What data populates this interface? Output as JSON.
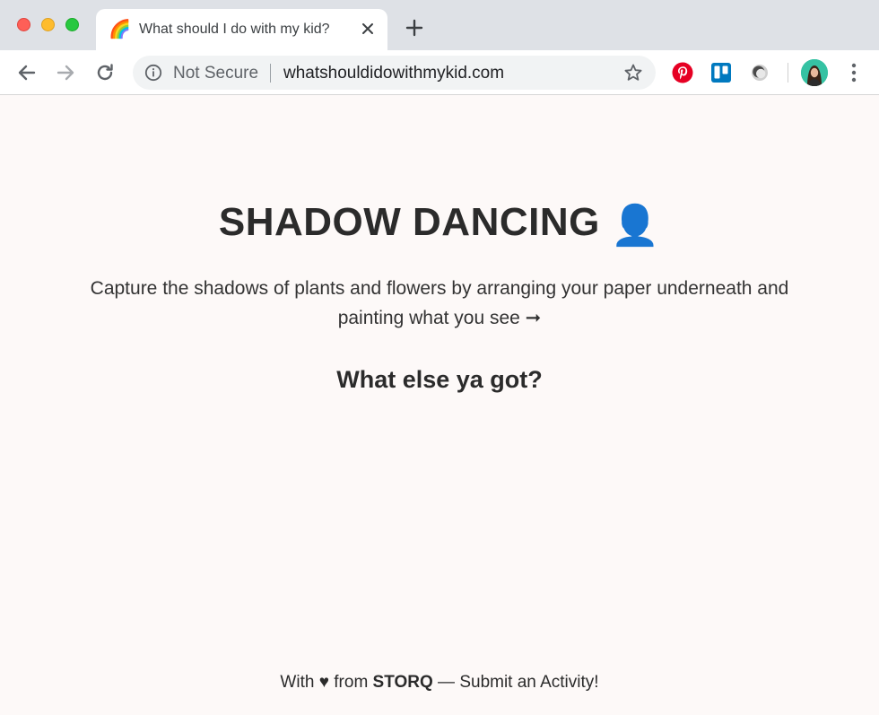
{
  "browser": {
    "tab": {
      "favicon": "🌈",
      "title": "What should I do with my kid?"
    },
    "new_tab_label": "+",
    "address_bar": {
      "security_label": "Not Secure",
      "url": "whatshouldidowithmykid.com"
    },
    "icons": {
      "back": "arrow-left-icon",
      "forward": "arrow-right-icon",
      "reload": "reload-icon",
      "info": "info-icon",
      "bookmark": "star-icon",
      "extensions": [
        "pinterest-icon",
        "trello-icon",
        "shadow-icon"
      ],
      "menu": "more-vertical-icon"
    },
    "colors": {
      "pinterest": "#e60023",
      "trello": "#0079bf",
      "avatar_bg": "#35c2a3"
    }
  },
  "page": {
    "heading": "SHADOW DANCING",
    "heading_emoji": "👤",
    "description": "Capture the shadows of plants and flowers by arranging your paper underneath and painting what you see ➞",
    "else_link": "What else ya got?",
    "footer": {
      "prefix": "With",
      "heart": "♥",
      "from": "from",
      "brand": "STORQ",
      "dash": "—",
      "submit_link": "Submit an Activity!"
    },
    "colors": {
      "background": "#fdf9f8",
      "text": "#2b2b2b"
    }
  }
}
